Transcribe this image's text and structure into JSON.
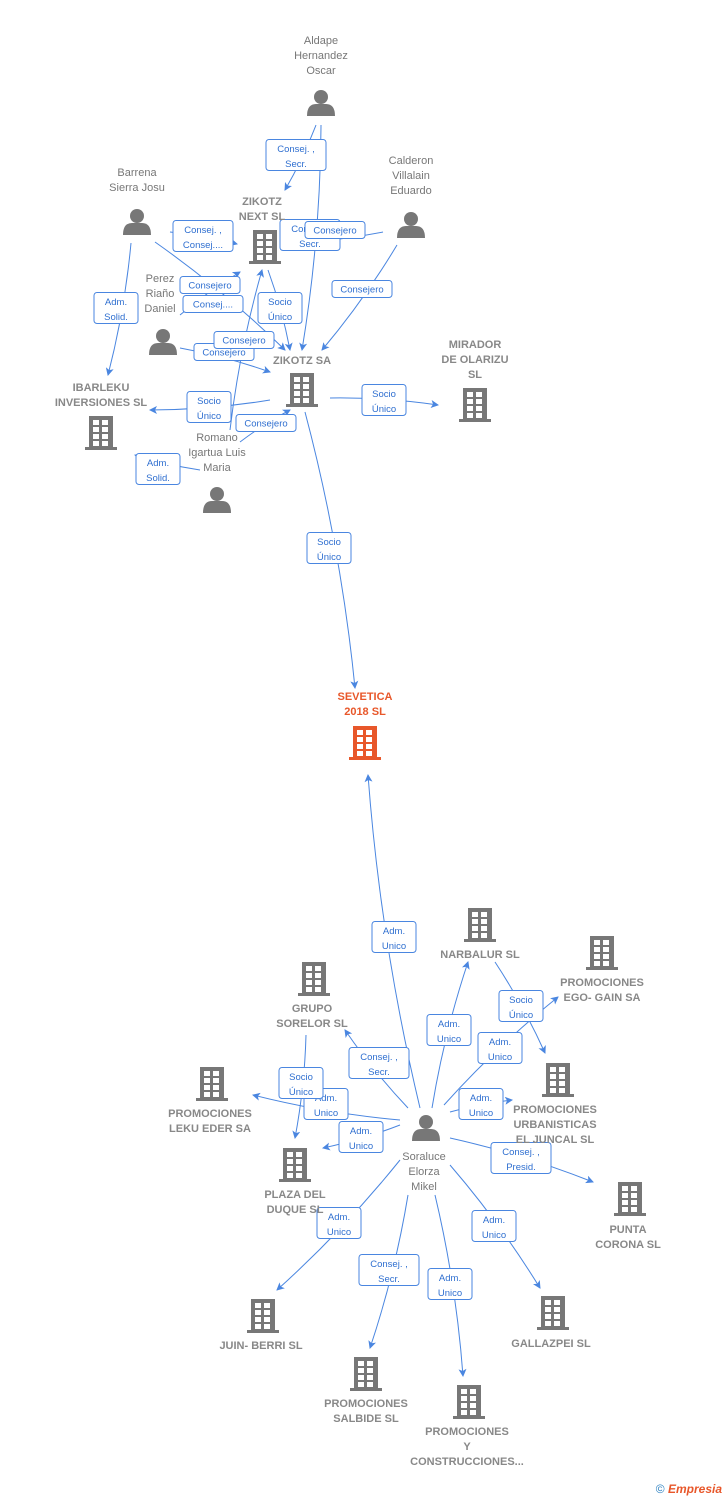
{
  "colors": {
    "edge": "#4a86e0",
    "node": "#777777",
    "highlight": "#e8572a"
  },
  "nodes": [
    {
      "id": "aldape",
      "type": "person",
      "lines": [
        "Aldape",
        "Hernandez",
        "Oscar"
      ]
    },
    {
      "id": "barrena",
      "type": "person",
      "lines": [
        "Barrena",
        "Sierra Josu"
      ]
    },
    {
      "id": "calderon",
      "type": "person",
      "lines": [
        "Calderon",
        "Villalain",
        "Eduardo"
      ]
    },
    {
      "id": "perez",
      "type": "person",
      "lines": [
        "Perez",
        "Riaño",
        "Daniel"
      ]
    },
    {
      "id": "romano",
      "type": "person",
      "lines": [
        "Romano",
        "Igartua Luis",
        "Maria"
      ]
    },
    {
      "id": "zikotz_next",
      "type": "company",
      "lines": [
        "ZIKOTZ",
        "NEXT  SL"
      ]
    },
    {
      "id": "zikotz_sa",
      "type": "company",
      "lines": [
        "ZIKOTZ SA"
      ]
    },
    {
      "id": "mirador",
      "type": "company",
      "lines": [
        "MIRADOR",
        "DE OLARIZU",
        "SL"
      ]
    },
    {
      "id": "ibarleku",
      "type": "company",
      "lines": [
        "IBARLEKU",
        "INVERSIONES SL"
      ]
    },
    {
      "id": "sevetica",
      "type": "company",
      "main": true,
      "lines": [
        "SEVETICA",
        "2018  SL"
      ]
    },
    {
      "id": "soraluce",
      "type": "person",
      "lines": [
        "Soraluce",
        "Elorza",
        "Mikel"
      ]
    },
    {
      "id": "narbalur",
      "type": "company",
      "lines": [
        "NARBALUR SL"
      ]
    },
    {
      "id": "ego_gain",
      "type": "company",
      "lines": [
        "PROMOCIONES",
        "EGO- GAIN SA"
      ]
    },
    {
      "id": "grupo_sorelor",
      "type": "company",
      "lines": [
        "GRUPO",
        "SORELOR SL"
      ]
    },
    {
      "id": "juncal",
      "type": "company",
      "lines": [
        "PROMOCIONES",
        "URBANISTICAS",
        "EL JUNCAL SL"
      ]
    },
    {
      "id": "leku_eder",
      "type": "company",
      "lines": [
        "PROMOCIONES",
        "LEKU EDER SA"
      ]
    },
    {
      "id": "plaza_duque",
      "type": "company",
      "lines": [
        "PLAZA DEL",
        "DUQUE  SL"
      ]
    },
    {
      "id": "punta_corona",
      "type": "company",
      "lines": [
        "PUNTA",
        "CORONA  SL"
      ]
    },
    {
      "id": "juin_berri",
      "type": "company",
      "lines": [
        "JUIN- BERRI SL"
      ]
    },
    {
      "id": "gallazpei",
      "type": "company",
      "lines": [
        "GALLAZPEI SL"
      ]
    },
    {
      "id": "salbide",
      "type": "company",
      "lines": [
        "PROMOCIONES",
        "SALBIDE SL"
      ]
    },
    {
      "id": "construcciones",
      "type": "company",
      "lines": [
        "PROMOCIONES",
        "Y",
        "CONSTRUCCIONES..."
      ]
    }
  ],
  "edges": [
    {
      "from": "aldape",
      "to": "zikotz_next",
      "lines": [
        "Consej. ,",
        "Secr."
      ]
    },
    {
      "from": "aldape",
      "to": "zikotz_sa",
      "lines": [
        "Consej. ,",
        "Secr."
      ]
    },
    {
      "from": "barrena",
      "to": "zikotz_next",
      "lines": [
        "Consej. ,",
        "Consej...."
      ]
    },
    {
      "from": "barrena",
      "to": "ibarleku",
      "lines": [
        "Adm.",
        "Solid."
      ]
    },
    {
      "from": "barrena",
      "to": "zikotz_sa",
      "lines": [
        "Consej...."
      ]
    },
    {
      "from": "perez",
      "to": "zikotz_next",
      "lines": [
        "Consejero"
      ]
    },
    {
      "from": "calderon",
      "to": "zikotz_next",
      "lines": [
        "Consejero"
      ]
    },
    {
      "from": "calderon",
      "to": "zikotz_sa",
      "lines": [
        "Consejero"
      ]
    },
    {
      "from": "zikotz_next",
      "to": "zikotz_sa",
      "lines": [
        "Socio",
        "Único"
      ]
    },
    {
      "from": "perez",
      "to": "zikotz_sa",
      "lines": [
        "Consejero"
      ]
    },
    {
      "from": "romano",
      "to": "zikotz_next",
      "lines": [
        "Consejero"
      ]
    },
    {
      "from": "zikotz_sa",
      "to": "ibarleku",
      "lines": [
        "Socio",
        "Único"
      ]
    },
    {
      "from": "romano",
      "to": "zikotz_sa",
      "lines": [
        "Consejero"
      ]
    },
    {
      "from": "romano",
      "to": "ibarleku",
      "lines": [
        "Adm.",
        "Solid."
      ]
    },
    {
      "from": "zikotz_sa",
      "to": "mirador",
      "lines": [
        "Socio",
        "Único"
      ]
    },
    {
      "from": "zikotz_sa",
      "to": "sevetica",
      "lines": [
        "Socio",
        "Único"
      ]
    },
    {
      "from": "soraluce",
      "to": "sevetica",
      "lines": [
        "Adm.",
        "Unico"
      ]
    },
    {
      "from": "soraluce",
      "to": "narbalur",
      "lines": [
        "Adm.",
        "Unico"
      ]
    },
    {
      "from": "soraluce",
      "to": "ego_gain",
      "lines": [
        "Adm.",
        "Unico"
      ]
    },
    {
      "from": "narbalur",
      "to": "juncal",
      "lines": [
        "Socio",
        "Único"
      ]
    },
    {
      "from": "soraluce",
      "to": "grupo_sorelor",
      "lines": [
        "Consej. ,",
        "Secr."
      ]
    },
    {
      "from": "soraluce",
      "to": "leku_eder",
      "lines": [
        "Adm.",
        "Unico"
      ]
    },
    {
      "from": "grupo_sorelor",
      "to": "plaza_duque",
      "lines": [
        "Socio",
        "Único"
      ]
    },
    {
      "from": "soraluce",
      "to": "plaza_duque",
      "lines": [
        "Adm.",
        "Unico"
      ]
    },
    {
      "from": "soraluce",
      "to": "juncal",
      "lines": [
        "Adm.",
        "Unico"
      ]
    },
    {
      "from": "soraluce",
      "to": "punta_corona",
      "lines": [
        "Consej. ,",
        "Presid."
      ]
    },
    {
      "from": "soraluce",
      "to": "juin_berri",
      "lines": [
        "Adm.",
        "Unico"
      ]
    },
    {
      "from": "soraluce",
      "to": "salbide",
      "lines": [
        "Consej. ,",
        "Secr."
      ]
    },
    {
      "from": "soraluce",
      "to": "construcciones",
      "lines": [
        "Adm.",
        "Unico"
      ]
    },
    {
      "from": "soraluce",
      "to": "gallazpei",
      "lines": [
        "Adm.",
        "Unico"
      ]
    }
  ],
  "footer": {
    "copyright": "©",
    "brand": "Empresia"
  }
}
